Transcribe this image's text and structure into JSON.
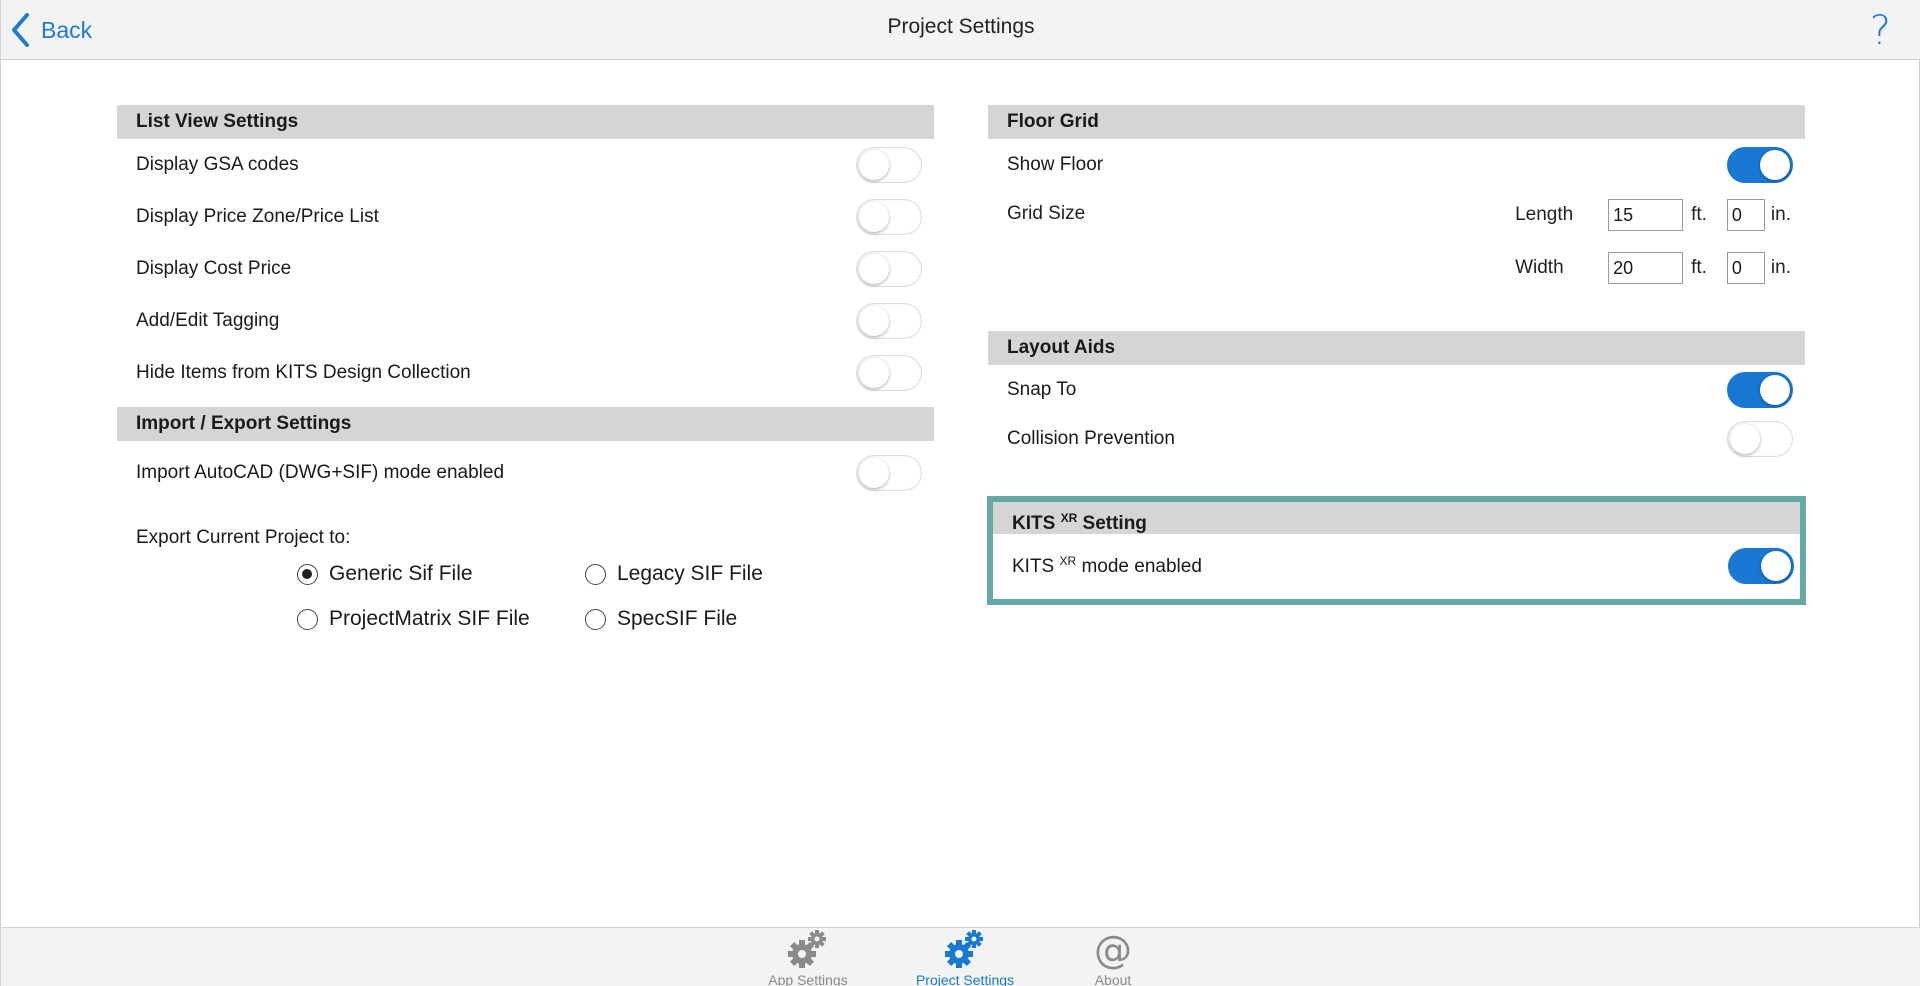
{
  "header": {
    "back_label": "Back",
    "title": "Project Settings",
    "help_label": "?"
  },
  "list_view": {
    "title": "List View Settings",
    "items": [
      {
        "label": "Display GSA codes",
        "on": false
      },
      {
        "label": "Display Price Zone/Price List",
        "on": false
      },
      {
        "label": "Display Cost Price",
        "on": false
      },
      {
        "label": "Add/Edit Tagging",
        "on": false
      },
      {
        "label": "Hide Items from KITS Design Collection",
        "on": false
      }
    ]
  },
  "import_export": {
    "title": "Import / Export Settings",
    "autocad_label": "Import AutoCAD (DWG+SIF) mode enabled",
    "autocad_on": false,
    "export_label": "Export Current Project to:",
    "options": [
      "Generic Sif File",
      "Legacy SIF File",
      "ProjectMatrix SIF File",
      "SpecSIF File"
    ],
    "selected": "Generic Sif File"
  },
  "floor_grid": {
    "title": "Floor Grid",
    "show_floor_label": "Show Floor",
    "show_floor_on": true,
    "grid_size_label": "Grid Size",
    "length_label": "Length",
    "length_ft": "15",
    "length_in": "0",
    "width_label": "Width",
    "width_ft": "20",
    "width_in": "0",
    "ft_unit": "ft.",
    "in_unit": "in."
  },
  "layout_aids": {
    "title": "Layout Aids",
    "snap_label": "Snap To",
    "snap_on": true,
    "collision_label": "Collision Prevention",
    "collision_on": false
  },
  "kits_xr": {
    "title_prefix": "KITS",
    "sup": "XR",
    "title_suffix": "Setting",
    "mode_prefix": "KITS",
    "mode_suffix": "mode enabled",
    "mode_on": true
  },
  "tabs": [
    {
      "label": "App Settings",
      "icon": "gears-icon",
      "active": false
    },
    {
      "label": "Project Settings",
      "icon": "gears-icon",
      "active": true
    },
    {
      "label": "About",
      "icon": "at-icon",
      "active": false
    }
  ],
  "colors": {
    "accent": "#1878d3",
    "highlight_border": "#64a9a6",
    "section_bg": "#d5d5d5"
  }
}
